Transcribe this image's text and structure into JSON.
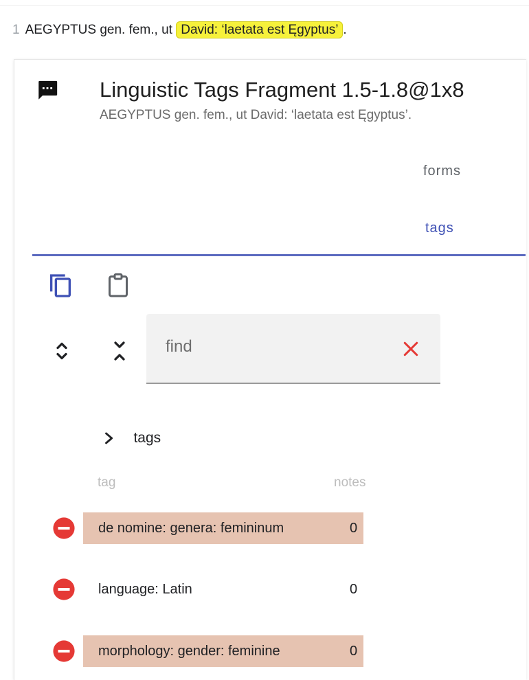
{
  "text_line": {
    "number": "1",
    "before": "AEGYPTUS gen. fem., ut",
    "highlight": "David: ‘laetata est Ęgyptus’",
    "after": "."
  },
  "part": {
    "title": "Linguistic Tags Fragment 1.5-1.8@1x8",
    "subtitle": "AEGYPTUS gen. fem., ut David: ‘laetata est Ęgyptus’."
  },
  "tabs": [
    {
      "label": "forms",
      "active": false
    },
    {
      "label": "tags",
      "active": true
    }
  ],
  "find": {
    "placeholder": "find",
    "value": ""
  },
  "tree": {
    "root_label": "tags"
  },
  "columns": {
    "tag": "tag",
    "notes": "notes"
  },
  "rows": [
    {
      "tag": "de nomine: genera: femininum",
      "notes": "0",
      "highlighted": true
    },
    {
      "tag": "language: Latin",
      "notes": "0",
      "highlighted": false
    },
    {
      "tag": "morphology: gender: feminine",
      "notes": "0",
      "highlighted": true
    }
  ],
  "colors": {
    "accent": "#3f51b5",
    "highlight_yellow": "#f6f13b",
    "row_highlight": "#e6c3b1",
    "delete_red": "#e53935",
    "clear_red": "#e53935"
  },
  "icons": {
    "part": "comment-icon",
    "copy": "copy-icon",
    "paste": "clipboard-icon",
    "expand": "unfold-more-icon",
    "collapse": "unfold-less-icon",
    "clear": "close-icon",
    "tree": "chevron-right-icon",
    "delete": "remove-circle-icon"
  }
}
